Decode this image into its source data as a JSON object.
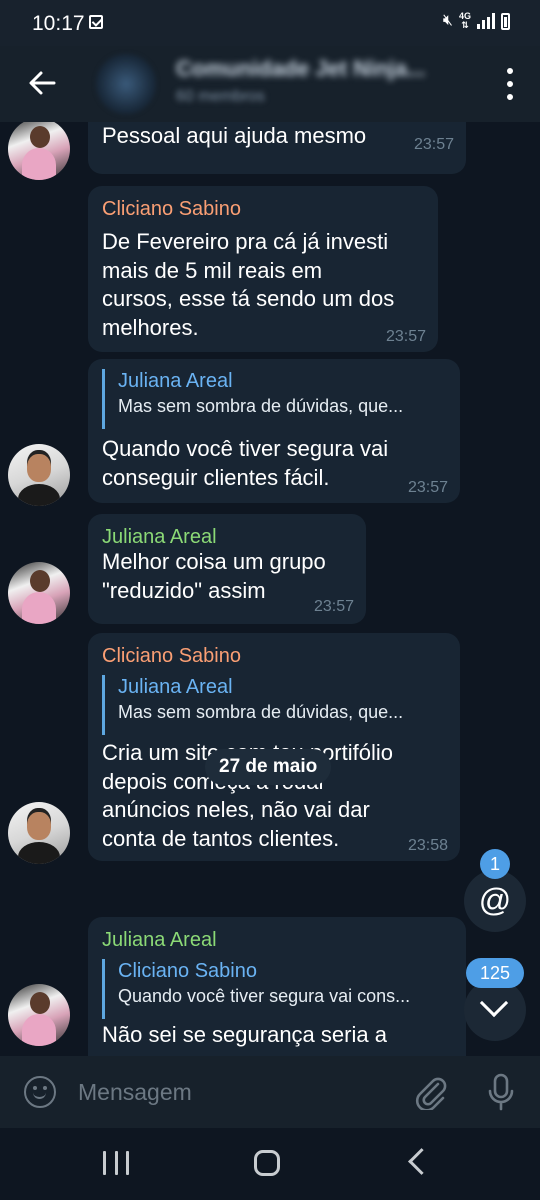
{
  "status_bar": {
    "time": "10:17",
    "network": "4G"
  },
  "header": {
    "title": "Comunidade Jet Ninja...",
    "subtitle": "60 membros"
  },
  "messages": [
    {
      "text": "Pessoal aqui ajuda mesmo",
      "time": "23:57"
    },
    {
      "sender": "Cliciano Sabino",
      "text_lines": [
        "De Fevereiro pra cá já investi",
        "mais de 5 mil reais em",
        "cursos, esse tá sendo um dos",
        "melhores."
      ],
      "time": "23:57"
    },
    {
      "reply_to": {
        "name": "Juliana Areal",
        "text": "Mas sem sombra de dúvidas, que..."
      },
      "text_lines": [
        "Quando você tiver segura vai",
        "conseguir clientes fácil."
      ],
      "time": "23:57"
    },
    {
      "sender": "Juliana Areal",
      "text_lines": [
        "Melhor coisa um grupo",
        "\"reduzido\" assim"
      ],
      "time": "23:57"
    },
    {
      "sender": "Cliciano Sabino",
      "reply_to": {
        "name": "Juliana Areal",
        "text": "Mas sem sombra de dúvidas, que..."
      },
      "text_lines": [
        "Cria um site com teu portifólio",
        "depois começa a rodar",
        "anúncios neles, não vai dar",
        "conta de tantos clientes."
      ],
      "time": "23:58"
    },
    {
      "sender": "Juliana Areal",
      "reply_to": {
        "name": "Cliciano Sabino",
        "text": "Quando você tiver segura vai cons..."
      },
      "text_lines": [
        "Não sei se segurança seria a"
      ]
    }
  ],
  "date_separator": "27 de maio",
  "mention_badge": "1",
  "unread_badge": "125",
  "input": {
    "placeholder": "Mensagem"
  },
  "colors": {
    "bubble": "#182533",
    "background": "#0e1621",
    "accent": "#4e9ee6",
    "name_orange": "#fa9f74",
    "name_green": "#8bd976",
    "reply_blue": "#6ab3f3"
  }
}
